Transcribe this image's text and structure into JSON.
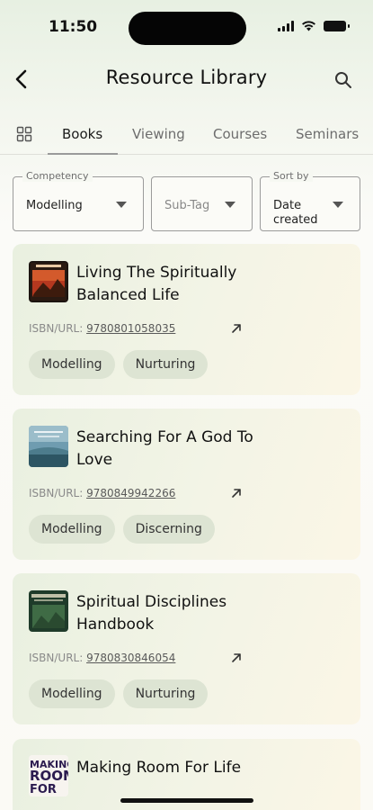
{
  "status_bar": {
    "time": "11:50"
  },
  "header": {
    "title": "Resource Library"
  },
  "tabs": [
    {
      "label": "Books",
      "active": true
    },
    {
      "label": "Viewing",
      "active": false
    },
    {
      "label": "Courses",
      "active": false
    },
    {
      "label": "Seminars",
      "active": false
    }
  ],
  "filters": {
    "competency": {
      "legend": "Competency",
      "value": "Modelling"
    },
    "subtag": {
      "value": "Sub-Tag"
    },
    "sort": {
      "legend": "Sort by",
      "value": "Date created"
    }
  },
  "books": [
    {
      "title": "Living The Spiritually Balanced Life",
      "isbn_label": "ISBN/URL:",
      "isbn": "9780801058035",
      "tags": [
        "Modelling",
        "Nurturing"
      ]
    },
    {
      "title": "Searching For A God To Love",
      "isbn_label": "ISBN/URL:",
      "isbn": "9780849942266",
      "tags": [
        "Modelling",
        "Discerning"
      ]
    },
    {
      "title": "Spiritual Disciplines Handbook",
      "isbn_label": "ISBN/URL:",
      "isbn": "9780830846054",
      "tags": [
        "Modelling",
        "Nurturing"
      ]
    },
    {
      "title": "Making Room For Life",
      "cover_text": "MAKING ROOM FOR LIFE"
    }
  ],
  "colors": {
    "card_bg": "#eef2e2",
    "chip_bg": "#dde4d3",
    "text": "#1d1d1d"
  }
}
